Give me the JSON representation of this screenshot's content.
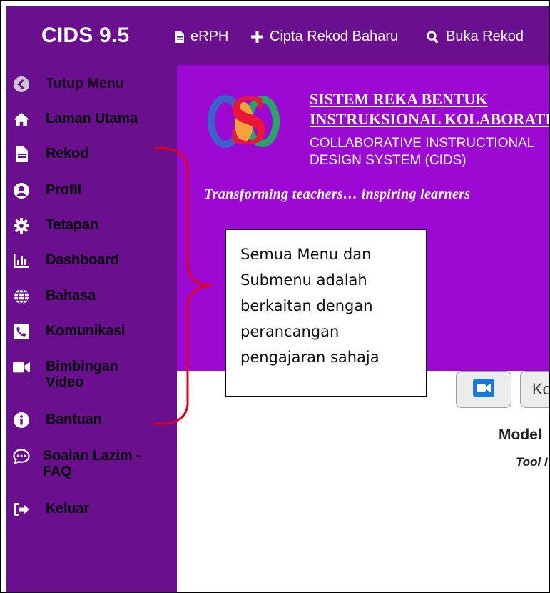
{
  "app": {
    "brand": "CIDS 9.5",
    "accent_color": "#6a0f8e",
    "banner_color": "#9b09d3"
  },
  "topnav": [
    {
      "label": "eRPH",
      "icon": "file-icon"
    },
    {
      "label": "Cipta Rekod Baharu",
      "icon": "plus-icon"
    },
    {
      "label": "Buka Rekod",
      "icon": "search-icon"
    }
  ],
  "sidebar": {
    "items": [
      {
        "label": "Tutup Menu",
        "icon": "chevron-left-circle-icon"
      },
      {
        "label": "Laman Utama",
        "icon": "home-icon"
      },
      {
        "label": "Rekod",
        "icon": "file-icon"
      },
      {
        "label": "Profil",
        "icon": "user-circle-icon"
      },
      {
        "label": "Tetapan",
        "icon": "gear-icon"
      },
      {
        "label": "Dashboard",
        "icon": "bar-chart-icon"
      },
      {
        "label": "Bahasa",
        "icon": "globe-icon"
      },
      {
        "label": "Komunikasi",
        "icon": "phone-icon"
      },
      {
        "label": "Bimbingan\nVideo",
        "icon": "video-camera-icon"
      },
      {
        "label": "Bantuan",
        "icon": "info-circle-icon"
      },
      {
        "label": "Soalan Lazim -\nFAQ",
        "icon": "chat-bubble-icon"
      },
      {
        "label": "Keluar",
        "icon": "sign-out-icon"
      }
    ]
  },
  "banner": {
    "title_line1": "SISTEM REKA BENTUK",
    "title_line2": "INSTRUKSIONAL KOLABORATIF",
    "subtitle_line1": "COLLABORATIVE INSTRUCTIONAL",
    "subtitle_line2": "DESIGN SYSTEM (CIDS)",
    "tagline": "Transforming teachers… inspiring learners"
  },
  "callout": {
    "lines": [
      "Semua Menu dan",
      "Submenu adalah",
      "berkaitan dengan",
      "perancangan",
      "pengajaran sahaja"
    ],
    "bracket_color": "#e0001b"
  },
  "content": {
    "video_button_icon": "video-camera-icon",
    "k_button_label": "Ko",
    "model_label": "Model",
    "tool_label": "Tool I"
  }
}
